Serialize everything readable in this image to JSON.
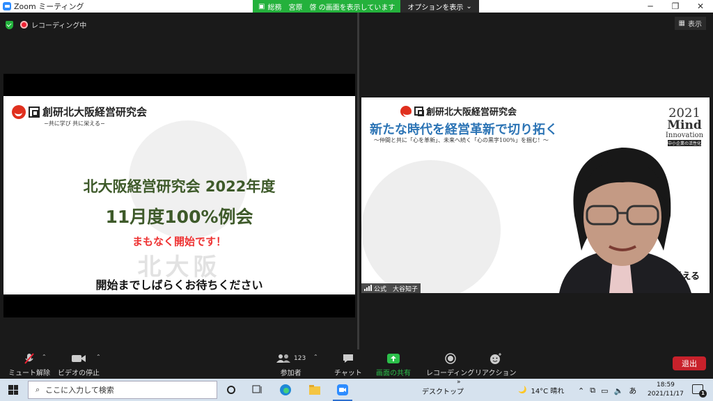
{
  "window": {
    "title": "Zoom ミーティング"
  },
  "share_bar": {
    "status": "総務　宮原　啓 の画面を表示しています",
    "options": "オプションを表示"
  },
  "meeting": {
    "recording": "レコーディング中",
    "view": "表示"
  },
  "slide": {
    "org": "創研北大阪経営研究会",
    "org_sub": "−共に学び 共に栄える−",
    "line1": "北大阪経営研究会 2022年度",
    "line2": "11月度100%例会",
    "line3": "まもなく開始です！",
    "watermark": "北大阪",
    "line4": "開始までしばらくお待ちください"
  },
  "video": {
    "org": "創研北大阪経営研究会",
    "headline": "新たな時代を経営革新で切り拓く",
    "subline": "〜仲間と共に「心を革新」、未来へ続く「心の黒字100%」を掴む！〜",
    "badge_year": "2021",
    "badge_mind": "Mind",
    "badge_innov": "Innovation",
    "badge_caption": "中小企業の活性化",
    "tagline": "学び 共に栄える",
    "name_label": "公式　大谷知子"
  },
  "toolbar": {
    "mute": "ミュート解除",
    "video": "ビデオの停止",
    "participants": "参加者",
    "participants_count": "123",
    "chat": "チャット",
    "share": "画面の共有",
    "record": "レコーディング",
    "reactions": "リアクション",
    "leave": "退出"
  },
  "taskbar": {
    "search_placeholder": "ここに入力して検索",
    "desktop": "デスクトップ",
    "weather": "14°C 晴れ",
    "ime": "あ",
    "time": "18:59",
    "date": "2021/11/17",
    "notifications": "1"
  },
  "colors": {
    "zoom_blue": "#2d8cff",
    "share_green": "#24b13c",
    "leave_red": "#c8212b",
    "slide_green": "#3e5a2a",
    "headline_blue": "#2c74b5"
  }
}
